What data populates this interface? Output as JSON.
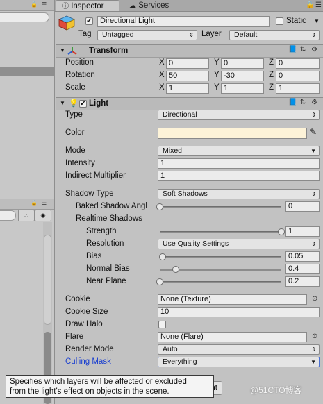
{
  "tabs": {
    "inspector": "Inspector",
    "services": "Services"
  },
  "object": {
    "name": "Directional Light",
    "static_label": "Static",
    "tag_label": "Tag",
    "tag_value": "Untagged",
    "layer_label": "Layer",
    "layer_value": "Default"
  },
  "transform": {
    "title": "Transform",
    "position": {
      "label": "Position",
      "x": "0",
      "y": "0",
      "z": "0"
    },
    "rotation": {
      "label": "Rotation",
      "x": "50",
      "y": "-30",
      "z": "0"
    },
    "scale": {
      "label": "Scale",
      "x": "1",
      "y": "1",
      "z": "1"
    },
    "axis": {
      "x": "X",
      "y": "Y",
      "z": "Z"
    }
  },
  "light": {
    "title": "Light",
    "type": {
      "label": "Type",
      "value": "Directional"
    },
    "color": {
      "label": "Color",
      "hex": "#fdf3d8"
    },
    "mode": {
      "label": "Mode",
      "value": "Mixed"
    },
    "intensity": {
      "label": "Intensity",
      "value": "1"
    },
    "indirect": {
      "label": "Indirect Multiplier",
      "value": "1"
    },
    "shadow_type": {
      "label": "Shadow Type",
      "value": "Soft Shadows"
    },
    "baked_angle": {
      "label": "Baked Shadow Angl",
      "value": "0",
      "fraction": 0.0
    },
    "realtime_shadows": "Realtime Shadows",
    "strength": {
      "label": "Strength",
      "value": "1",
      "fraction": 1.0
    },
    "resolution": {
      "label": "Resolution",
      "value": "Use Quality Settings"
    },
    "bias": {
      "label": "Bias",
      "value": "0.05",
      "fraction": 0.025
    },
    "normal_bias": {
      "label": "Normal Bias",
      "value": "0.4",
      "fraction": 0.133
    },
    "near_plane": {
      "label": "Near Plane",
      "value": "0.2",
      "fraction": 0.0
    },
    "cookie": {
      "label": "Cookie",
      "value": "None (Texture)"
    },
    "cookie_size": {
      "label": "Cookie Size",
      "value": "10"
    },
    "draw_halo": {
      "label": "Draw Halo"
    },
    "flare": {
      "label": "Flare",
      "value": "None (Flare)"
    },
    "render_mode": {
      "label": "Render Mode",
      "value": "Auto"
    },
    "culling_mask": {
      "label": "Culling Mask",
      "value": "Everything"
    }
  },
  "tooltip": {
    "line1": "Specifies which layers will be affected or excluded",
    "line2": "from the light's effect on objects in the scene."
  },
  "partial_button": "nt",
  "watermark": "@51CTO博客",
  "colors": {
    "culling_label": "#1a3fd0"
  }
}
